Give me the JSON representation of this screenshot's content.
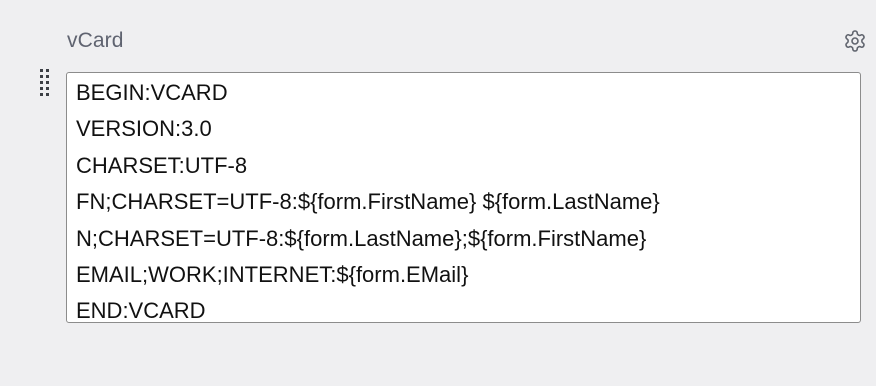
{
  "field": {
    "label": "vCard",
    "icons": {
      "settings": "gear-icon",
      "drag": "drag-handle-icon"
    },
    "content_lines": [
      "BEGIN:VCARD",
      "VERSION:3.0",
      "CHARSET:UTF-8",
      "FN;CHARSET=UTF-8:${form.FirstName} ${form.LastName}",
      "N;CHARSET=UTF-8:${form.LastName};${form.FirstName}",
      "EMAIL;WORK;INTERNET:${form.EMail}",
      "END:VCARD"
    ]
  },
  "colors": {
    "background": "#efeff1",
    "label": "#5f6370",
    "icon": "#60646e",
    "border": "#8c8c8c"
  }
}
